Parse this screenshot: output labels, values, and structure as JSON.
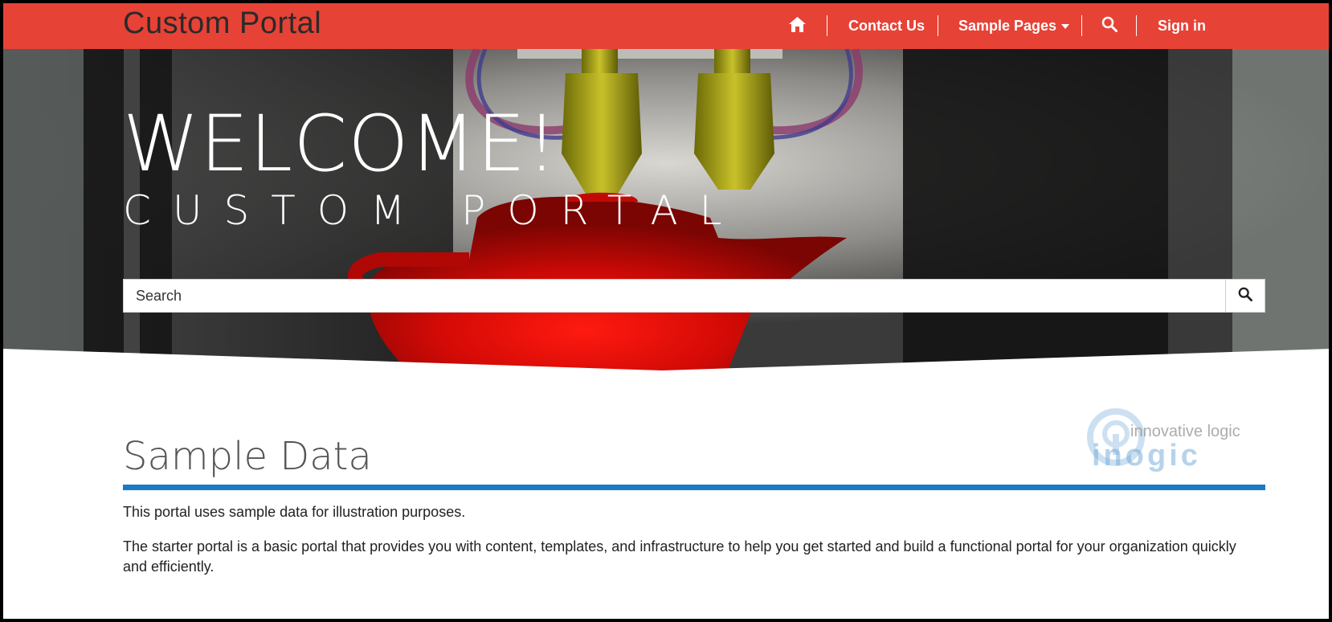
{
  "navbar": {
    "brand": "Custom Portal",
    "home_icon": "home-icon",
    "items": [
      {
        "label": "Contact Us"
      },
      {
        "label": "Sample Pages"
      }
    ],
    "search_icon": "search-icon",
    "sign_in_label": "Sign in",
    "color": "#e74236"
  },
  "hero": {
    "title": "WELCOME!",
    "subtitle": "CUSTOM PORTAL",
    "search": {
      "placeholder": "Search",
      "value": "",
      "button_icon": "search-icon"
    }
  },
  "content": {
    "section_title": "Sample Data",
    "accent_color": "#1b7ac5",
    "paragraphs": [
      "This portal uses sample data for illustration purposes.",
      "The starter portal is a basic portal that provides you with content, templates, and infrastructure to help you get started and build a functional portal for your organization quickly and efficiently."
    ]
  },
  "watermark": {
    "tagline": "innovative logic",
    "name": "inogic"
  }
}
